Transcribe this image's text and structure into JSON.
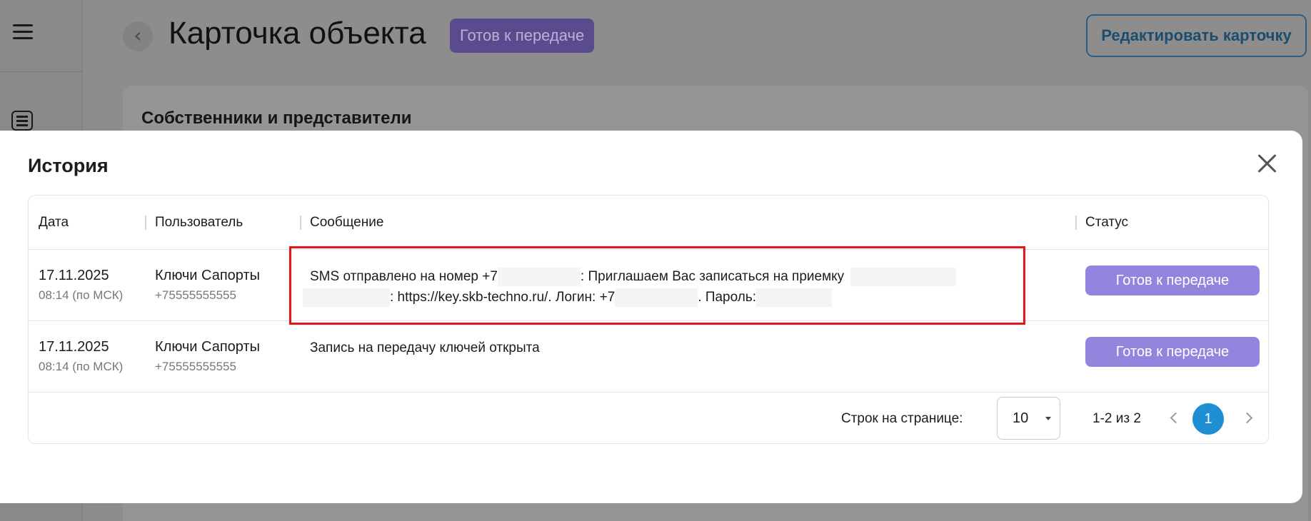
{
  "background": {
    "title": "Карточка объекта",
    "badge": "Готов к передаче",
    "edit_button": "Редактировать карточку",
    "section_title": "Собственники и представители"
  },
  "modal": {
    "title": "История",
    "columns": [
      "Дата",
      "Пользователь",
      "Сообщение",
      "Статус"
    ],
    "rows": [
      {
        "date": "17.11.2025",
        "time": "08:14 (по МСК)",
        "user": "Ключи Сапорты",
        "phone": "+75555555555",
        "message": {
          "part1": "SMS отправлено на номер +7",
          "part2": ": Приглашаем Вас записаться на приемку",
          "part3": ": https://key.skb-techno.ru/. Логин: +7",
          "part4": ". Пароль:"
        },
        "status": "Готов к передаче"
      },
      {
        "date": "17.11.2025",
        "time": "08:14 (по МСК)",
        "user": "Ключи Сапорты",
        "phone": "+75555555555",
        "message": {
          "part1": "Запись на передачу ключей открыта"
        },
        "status": "Готов к передаче"
      }
    ],
    "footer": {
      "rows_label": "Строк на странице:",
      "rows_value": "10",
      "range": "1-2 из 2",
      "current_page": "1"
    }
  },
  "colors": {
    "status_bg": "#9584dd",
    "page_active": "#1f8fd3",
    "highlight": "#e8141a"
  }
}
